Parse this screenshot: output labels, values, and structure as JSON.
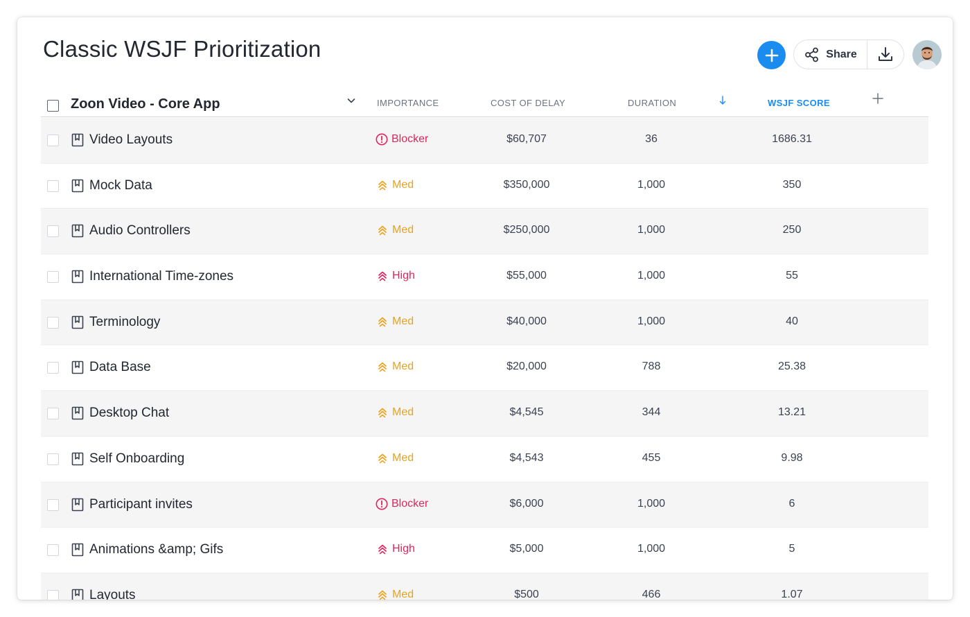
{
  "page": {
    "title": "Classic WSJF Prioritization",
    "share_label": "Share"
  },
  "colors": {
    "accent": "#1a8cf0",
    "blocker": "#e2245c",
    "high": "#e2245c",
    "med": "#e9a21a"
  },
  "table": {
    "group_name": "Zoon Video - Core App",
    "columns": {
      "importance": "IMPORTANCE",
      "cost_of_delay": "COST OF DELAY",
      "duration": "DURATION",
      "wsjf_score": "WSJF SCORE"
    },
    "rows": [
      {
        "name": "Video Layouts",
        "importance": "Blocker",
        "cost_of_delay": "$60,707",
        "duration": "36",
        "wsjf": "1686.31"
      },
      {
        "name": "Mock Data",
        "importance": "Med",
        "cost_of_delay": "$350,000",
        "duration": "1,000",
        "wsjf": "350"
      },
      {
        "name": "Audio Controllers",
        "importance": "Med",
        "cost_of_delay": "$250,000",
        "duration": "1,000",
        "wsjf": "250"
      },
      {
        "name": "International Time-zones",
        "importance": "High",
        "cost_of_delay": "$55,000",
        "duration": "1,000",
        "wsjf": "55"
      },
      {
        "name": "Terminology",
        "importance": "Med",
        "cost_of_delay": "$40,000",
        "duration": "1,000",
        "wsjf": "40"
      },
      {
        "name": "Data Base",
        "importance": "Med",
        "cost_of_delay": "$20,000",
        "duration": "788",
        "wsjf": "25.38"
      },
      {
        "name": "Desktop Chat",
        "importance": "Med",
        "cost_of_delay": "$4,545",
        "duration": "344",
        "wsjf": "13.21"
      },
      {
        "name": "Self Onboarding",
        "importance": "Med",
        "cost_of_delay": "$4,543",
        "duration": "455",
        "wsjf": "9.98"
      },
      {
        "name": "Participant invites",
        "importance": "Blocker",
        "cost_of_delay": "$6,000",
        "duration": "1,000",
        "wsjf": "6"
      },
      {
        "name": "Animations &amp; Gifs",
        "importance": "High",
        "cost_of_delay": "$5,000",
        "duration": "1,000",
        "wsjf": "5"
      },
      {
        "name": "Layouts",
        "importance": "Med",
        "cost_of_delay": "$500",
        "duration": "466",
        "wsjf": "1.07"
      }
    ]
  }
}
